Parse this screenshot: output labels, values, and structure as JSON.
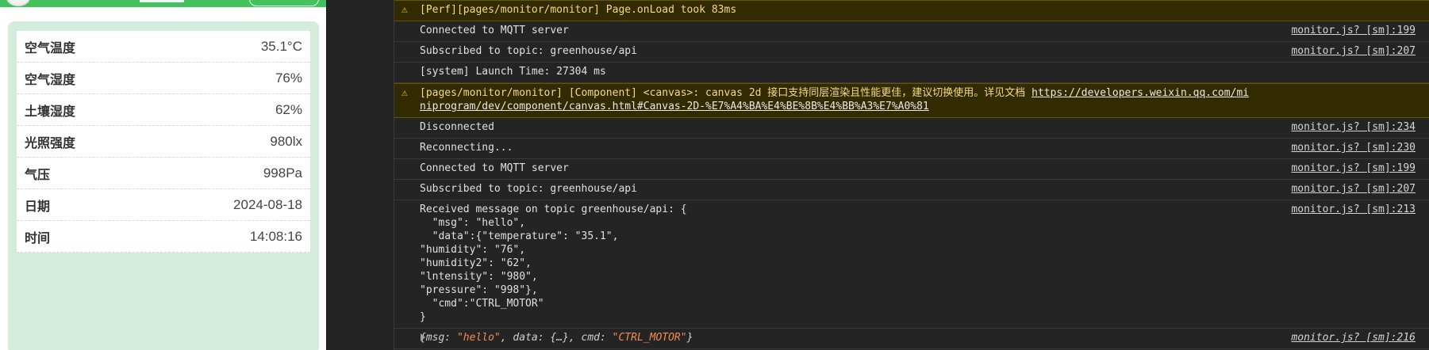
{
  "sensor_panel": {
    "rows": [
      {
        "label": "空气温度",
        "value": "35.1°C"
      },
      {
        "label": "空气湿度",
        "value": "76%"
      },
      {
        "label": "土壤湿度",
        "value": "62%"
      },
      {
        "label": "光照强度",
        "value": "980lx"
      },
      {
        "label": "气压",
        "value": "998Pa"
      },
      {
        "label": "日期",
        "value": "2024-08-18"
      },
      {
        "label": "时间",
        "value": "14:08:16"
      }
    ]
  },
  "console": {
    "perf_warning": "[Perf][pages/monitor/monitor] Page.onLoad took 83ms",
    "logs": [
      {
        "text": "Connected to MQTT server",
        "source": "monitor.js? [sm]:199"
      },
      {
        "text": "Subscribed to topic: greenhouse/api",
        "source": "monitor.js? [sm]:207"
      },
      {
        "text": "[system] Launch Time: 27304 ms",
        "source": ""
      }
    ],
    "canvas_warning": {
      "text": "[pages/monitor/monitor] [Component] <canvas>: canvas 2d 接口支持同层渲染且性能更佳，建议切换使用。详见文档 ",
      "link": "https://developers.weixin.qq.com/miniprogram/dev/component/canvas.html#Canvas-2D-%E7%A4%BA%E4%BE%8B%E4%BB%A3%E7%A0%81"
    },
    "logs2": [
      {
        "text": "Disconnected",
        "source": "monitor.js? [sm]:234"
      },
      {
        "text": "Reconnecting...",
        "source": "monitor.js? [sm]:230"
      },
      {
        "text": "Connected to MQTT server",
        "source": "monitor.js? [sm]:199"
      },
      {
        "text": "Subscribed to topic: greenhouse/api",
        "source": "monitor.js? [sm]:207"
      }
    ],
    "received": {
      "text": "Received message on topic greenhouse/api: {\n  \"msg\": \"hello\",\n  \"data\":{\"temperature\": \"35.1\",\n\"humidity\": \"76\",\n\"humidity2\": \"62\",\n\"lntensity\": \"980\",\n\"pressure\": \"998\"},\n  \"cmd\":\"CTRL_MOTOR\"\n}",
      "source": "monitor.js? [sm]:213"
    },
    "object_row": {
      "open": "{",
      "k1": "msg: ",
      "v1": "\"hello\"",
      "mid": ", data: {…}, ",
      "k3": "cmd: ",
      "v3": "\"CTRL_MOTOR\"",
      "close": "}",
      "source": "monitor.js? [sm]:216"
    }
  },
  "icons": {
    "warning": "⚠"
  },
  "colors": {
    "header_green": "#43c15d",
    "card_bg": "#d3ecdc",
    "console_bg": "#242424",
    "warn_bg": "#332b00",
    "string_orange": "#f28b54"
  }
}
